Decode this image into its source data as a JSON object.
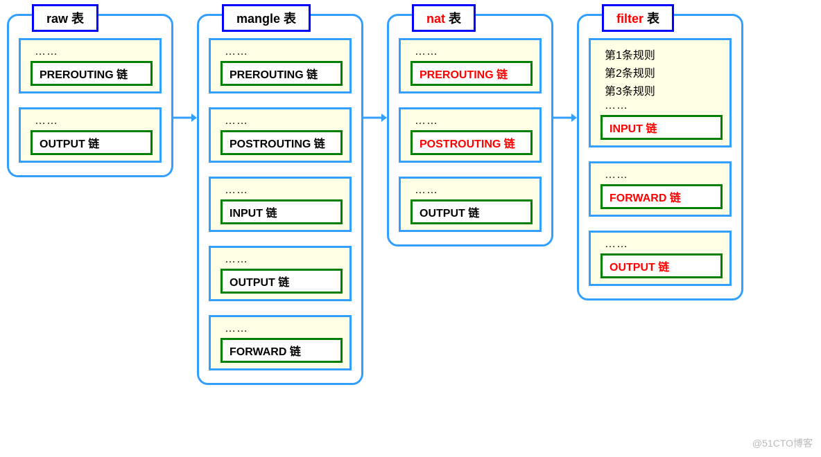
{
  "tables": [
    {
      "key": "raw",
      "title_name": "raw",
      "title_suffix": " 表",
      "title_red": false,
      "chains": [
        {
          "pre": [
            "……"
          ],
          "label": "PREROUTING 链",
          "red": false
        },
        {
          "pre": [
            "……"
          ],
          "label": "OUTPUT 链",
          "red": false
        }
      ]
    },
    {
      "key": "mangle",
      "title_name": "mangle",
      "title_suffix": " 表",
      "title_red": false,
      "chains": [
        {
          "pre": [
            "……"
          ],
          "label": "PREROUTING 链",
          "red": false
        },
        {
          "pre": [
            "……"
          ],
          "label": "POSTROUTING 链",
          "red": false
        },
        {
          "pre": [
            "……"
          ],
          "label": "INPUT 链",
          "red": false
        },
        {
          "pre": [
            "……"
          ],
          "label": "OUTPUT 链",
          "red": false
        },
        {
          "pre": [
            "……"
          ],
          "label": "FORWARD 链",
          "red": false
        }
      ]
    },
    {
      "key": "nat",
      "title_name": "nat",
      "title_suffix": " 表",
      "title_red": true,
      "chains": [
        {
          "pre": [
            "……"
          ],
          "label": "PREROUTING 链",
          "red": true
        },
        {
          "pre": [
            "……"
          ],
          "label": "POSTROUTING 链",
          "red": true
        },
        {
          "pre": [
            "……"
          ],
          "label": "OUTPUT 链",
          "red": false
        }
      ]
    },
    {
      "key": "filter",
      "title_name": "filter",
      "title_suffix": " 表",
      "title_red": true,
      "chains": [
        {
          "pre": [
            "第1条规则",
            "第2条规则",
            "第3条规则",
            "……"
          ],
          "label": "INPUT 链",
          "red": true
        },
        {
          "pre": [
            "……"
          ],
          "label": "FORWARD 链",
          "red": true
        },
        {
          "pre": [
            "……"
          ],
          "label": "OUTPUT 链",
          "red": true
        }
      ]
    }
  ],
  "watermark": "@51CTO博客"
}
